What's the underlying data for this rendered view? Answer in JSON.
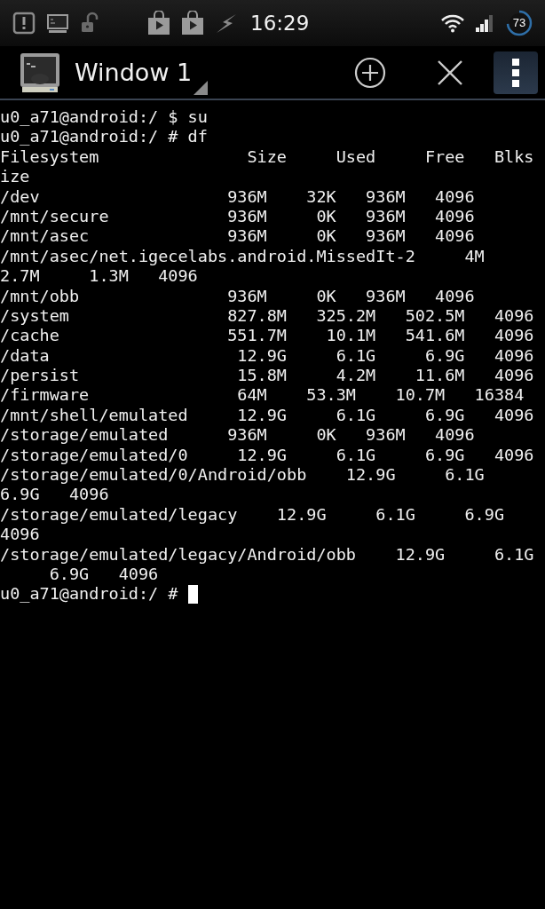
{
  "status_bar": {
    "time": "16:29",
    "battery": "73"
  },
  "app_bar": {
    "title": "Window 1"
  },
  "terminal": {
    "lines": [
      "u0_a71@android:/ $ su",
      "u0_a71@android:/ # df",
      "Filesystem               Size     Used     Free   Blks",
      "ize",
      "/dev                   936M    32K   936M   4096",
      "/mnt/secure            936M     0K   936M   4096",
      "/mnt/asec              936M     0K   936M   4096",
      "/mnt/asec/net.igecelabs.android.MissedIt-2     4M",
      "2.7M     1.3M   4096",
      "/mnt/obb               936M     0K   936M   4096",
      "/system                827.8M   325.2M   502.5M   4096",
      "/cache                 551.7M    10.1M   541.6M   4096",
      "/data                   12.9G     6.1G     6.9G   4096",
      "/persist                15.8M     4.2M    11.6M   4096",
      "/firmware               64M    53.3M    10.7M   16384",
      "/mnt/shell/emulated     12.9G     6.1G     6.9G   4096",
      "/storage/emulated      936M     0K   936M   4096",
      "/storage/emulated/0     12.9G     6.1G     6.9G   4096",
      "/storage/emulated/0/Android/obb    12.9G     6.1G",
      "6.9G   4096",
      "/storage/emulated/legacy    12.9G     6.1G     6.9G",
      "4096",
      "/storage/emulated/legacy/Android/obb    12.9G     6.1G",
      "     6.9G   4096",
      "u0_a71@android:/ # "
    ],
    "cursor_visible": true
  }
}
